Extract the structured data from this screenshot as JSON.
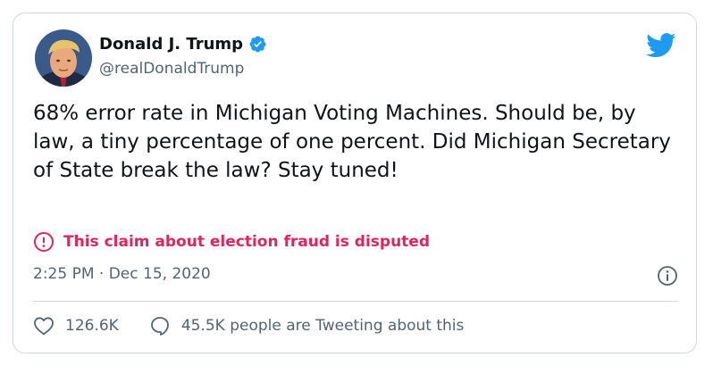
{
  "author": {
    "display_name": "Donald J. Trump",
    "handle": "@realDonaldTrump",
    "verified_icon": "verified-badge-icon",
    "avatar": "avatar-photo"
  },
  "tweet": {
    "text": "68% error rate in Michigan Voting Machines. Should be, by law, a tiny percentage of one percent. Did Michigan Secretary of State break the law? Stay tuned!"
  },
  "label": {
    "text": "This claim about election fraud is disputed",
    "icon": "alert-icon",
    "color": "#e0245e"
  },
  "meta": {
    "timestamp": "2:25 PM · Dec 15, 2020",
    "info_icon": "info-icon"
  },
  "footer": {
    "likes": "126.6K",
    "talking": "45.5K people are Tweeting about this",
    "like_icon": "heart-icon",
    "reply_icon": "speech-bubble-icon"
  },
  "colors": {
    "brand": "#1d9bf0",
    "text_primary": "#0f1419",
    "text_secondary": "#536471",
    "border": "#cfd9de"
  }
}
